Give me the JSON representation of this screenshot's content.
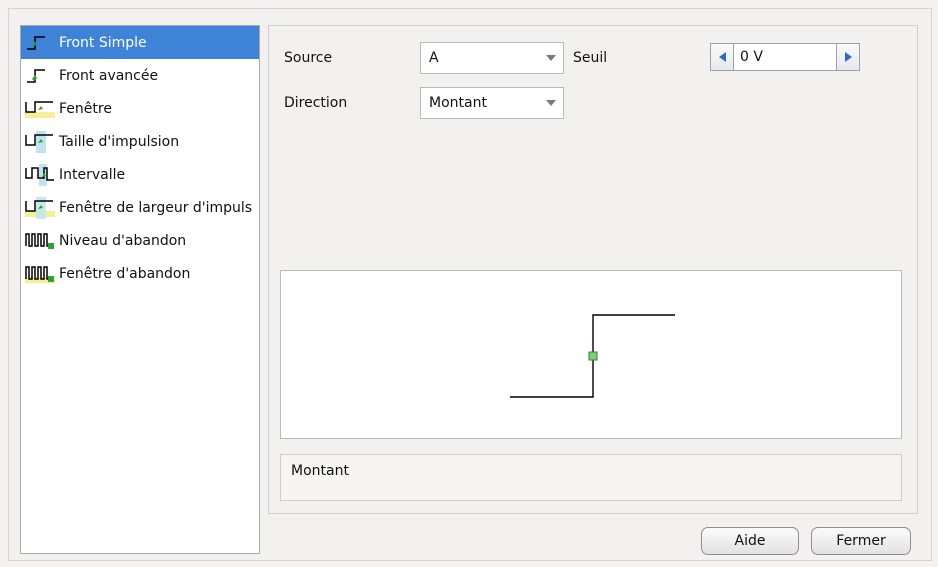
{
  "trigger_types": [
    {
      "label": "Front Simple",
      "icon": "simple-edge-icon",
      "selected": true
    },
    {
      "label": "Front avancée",
      "icon": "advanced-edge-icon",
      "selected": false
    },
    {
      "label": "Fenêtre",
      "icon": "window-icon",
      "selected": false
    },
    {
      "label": "Taille d'impulsion",
      "icon": "pulse-width-icon",
      "selected": false
    },
    {
      "label": "Intervalle",
      "icon": "interval-icon",
      "selected": false
    },
    {
      "label": "Fenêtre de largeur d'impuls",
      "icon": "window-pulse-width-icon",
      "selected": false
    },
    {
      "label": "Niveau d'abandon",
      "icon": "level-dropout-icon",
      "selected": false
    },
    {
      "label": "Fenêtre d'abandon",
      "icon": "window-dropout-icon",
      "selected": false
    }
  ],
  "settings": {
    "source_label": "Source",
    "source_value": "A",
    "threshold_label": "Seuil",
    "threshold_value": "0 V",
    "direction_label": "Direction",
    "direction_value": "Montant"
  },
  "description": "Montant",
  "buttons": {
    "help": "Aide",
    "close": "Fermer"
  },
  "colors": {
    "selection": "#3f83d9",
    "marker": "#7ecf7e",
    "icon_green": "#2ea52e",
    "icon_highlight_blue": "#bfe4ee",
    "icon_highlight_yellow": "#f5ef9a"
  }
}
